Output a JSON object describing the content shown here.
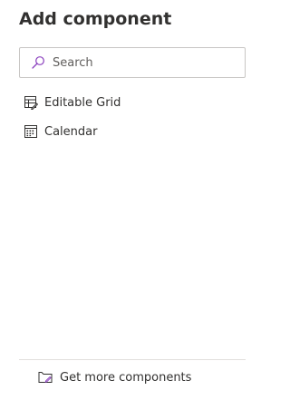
{
  "panel": {
    "title": "Add component"
  },
  "search": {
    "placeholder": "Search",
    "value": "",
    "icon": "search-icon",
    "icon_color": "#8a3fbd"
  },
  "components": [
    {
      "label": "Editable Grid",
      "icon": "editable-grid-icon"
    },
    {
      "label": "Calendar",
      "icon": "calendar-icon"
    }
  ],
  "footer": {
    "get_more_label": "Get more components",
    "icon": "store-icon"
  }
}
